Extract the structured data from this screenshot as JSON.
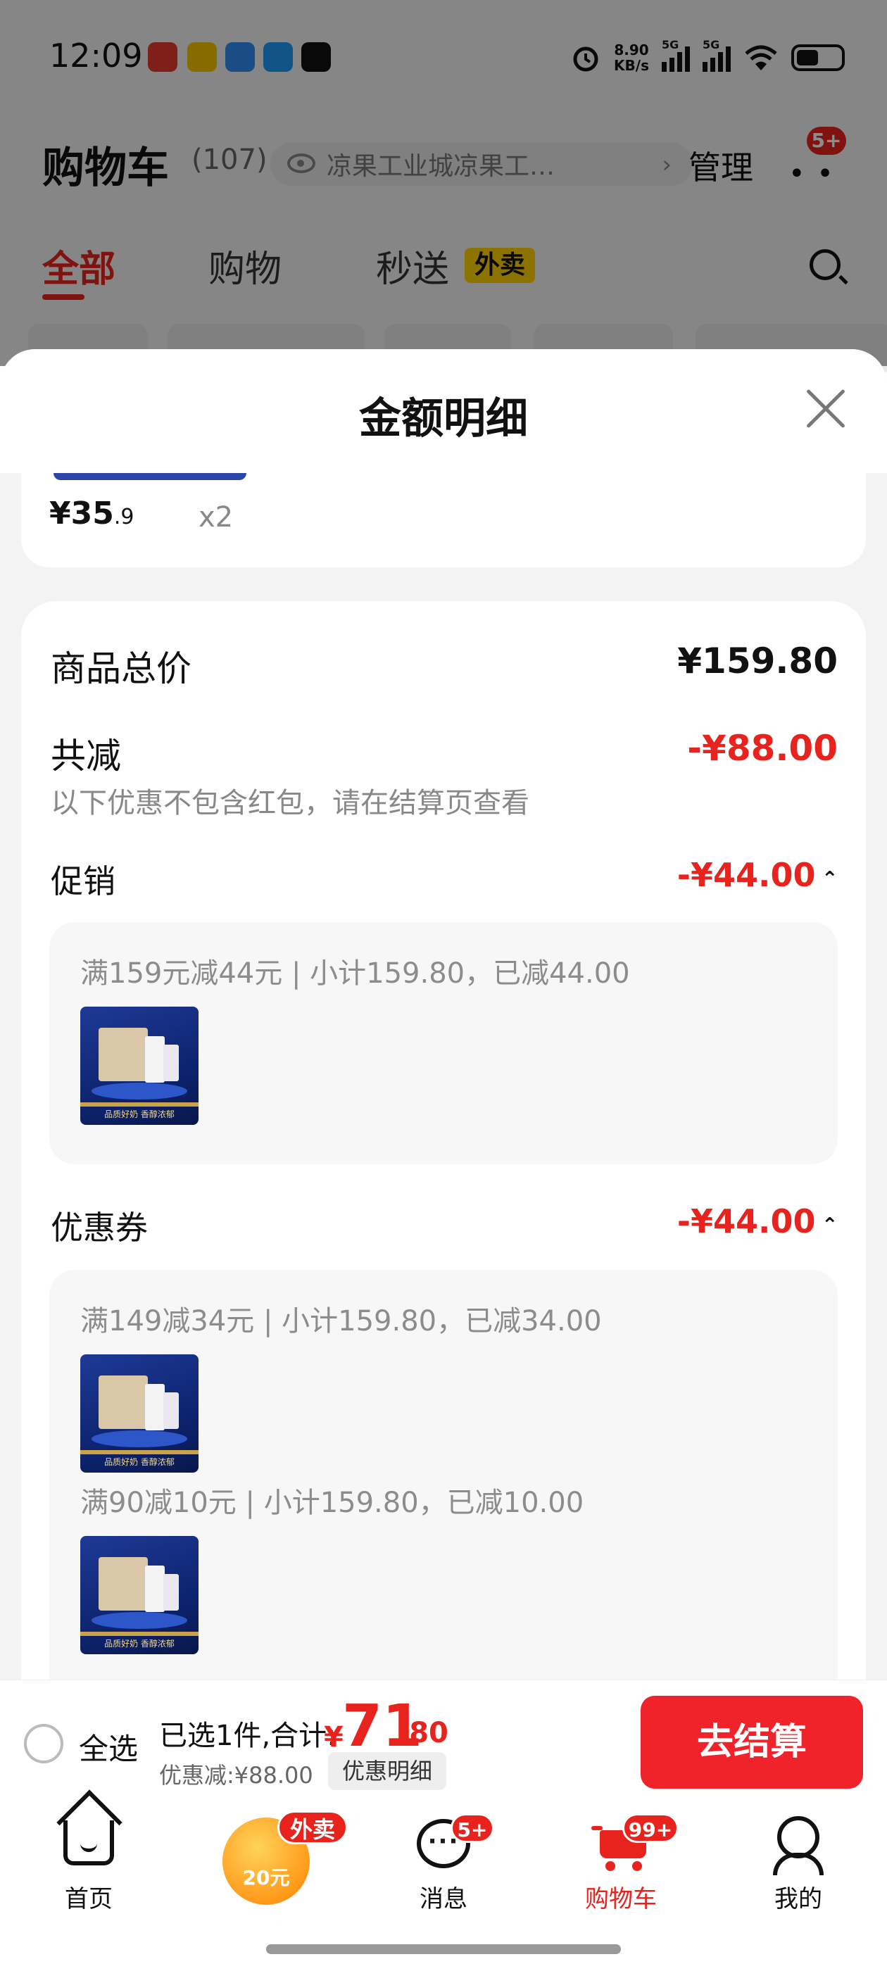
{
  "status_bar": {
    "time": "12:09",
    "net_speed_value": "8.90",
    "net_speed_unit": "KB/s",
    "signal_1_label": "5G",
    "signal_2_label": "5G"
  },
  "header": {
    "title": "购物车",
    "count": "(107)",
    "location": "凉果工业城凉果工…",
    "manage": "管理",
    "more_badge": "5+"
  },
  "tabs": {
    "all": "全部",
    "shopping": "购物",
    "instant": "秒送",
    "instant_tag": "外卖"
  },
  "sheet": {
    "title": "金额明细",
    "item": {
      "price_int": "¥35",
      "price_dec": ".9",
      "quantity": "x2"
    },
    "total_label": "商品总价",
    "total_value": "¥159.80",
    "reduce_label": "共减",
    "reduce_value": "-¥88.00",
    "reduce_note": "以下优惠不包含红包，请在结算页查看",
    "promotion": {
      "label": "促销",
      "value": "-¥44.00",
      "lines": [
        "满159元减44元 | 小计159.80，已减44.00"
      ]
    },
    "coupon": {
      "label": "优惠券",
      "value": "-¥44.00",
      "lines": [
        "满149减34元 | 小计159.80，已减34.00",
        "满90减10元 | 小计159.80，已减10.00"
      ]
    },
    "product_caption": "品质好奶 香醇浓郁"
  },
  "checkout": {
    "select_all": "全选",
    "selected": "已选1件,合计:",
    "total_symbol": "¥",
    "total_int": "71",
    "total_dec": ".80",
    "discount": "优惠减:¥88.00",
    "detail_button": "优惠明细",
    "checkout_button": "去结算"
  },
  "bottom_nav": {
    "home": "首页",
    "promo_badge": "外卖",
    "promo_coin": "20元",
    "messages": "消息",
    "messages_badge": "5+",
    "cart": "购物车",
    "cart_badge": "99+",
    "me": "我的"
  },
  "colors": {
    "accent_red": "#e8231d",
    "checkout_red": "#f0222a",
    "tag_yellow": "#ffd200"
  }
}
